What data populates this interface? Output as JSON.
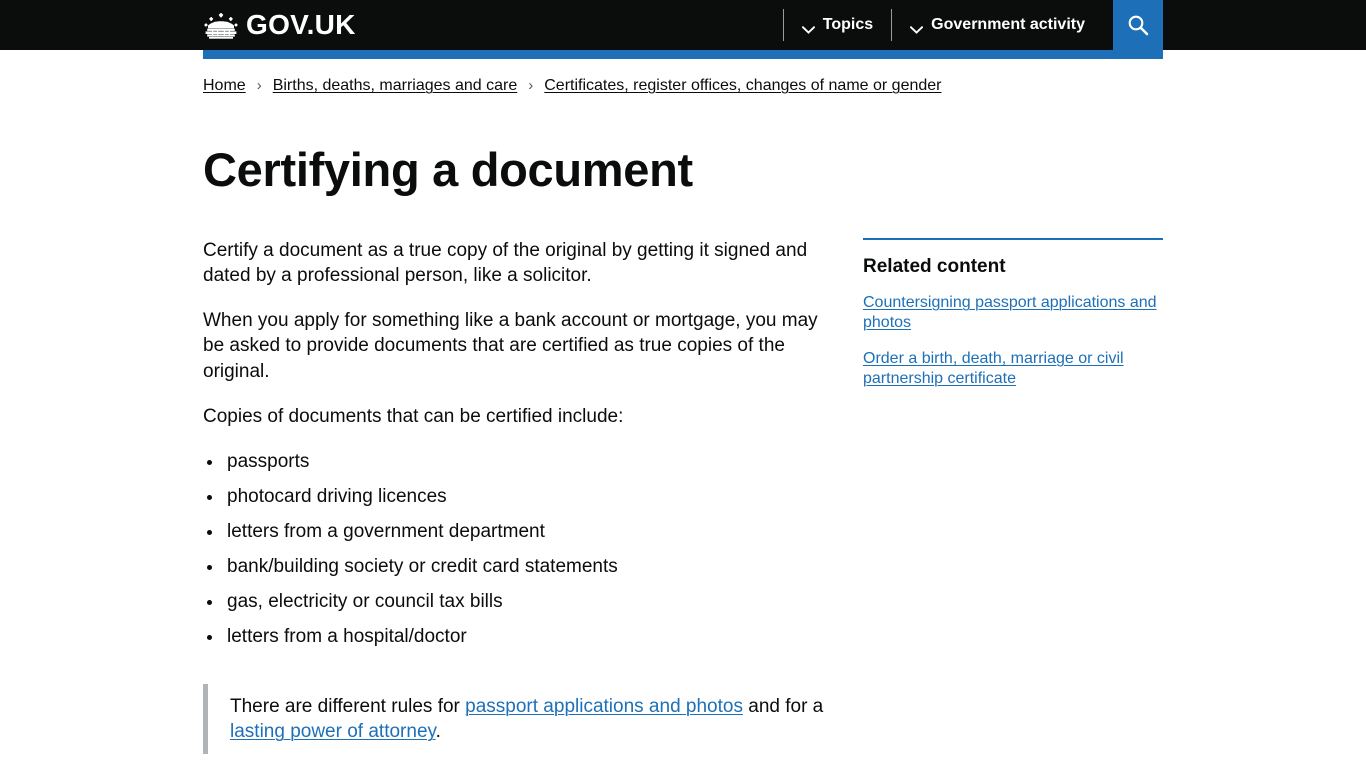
{
  "header": {
    "logo_text": "GOV.UK",
    "nav": [
      {
        "label": "Topics",
        "icon": "chevron-down-icon"
      },
      {
        "label": "Government activity",
        "icon": "chevron-down-icon"
      }
    ],
    "search_label": "Search",
    "accent_color": "#1d70b8",
    "background_color": "#0b0c0c"
  },
  "breadcrumb": {
    "items": [
      "Home",
      "Births, deaths, marriages and care",
      "Certificates, register offices, changes of name or gender"
    ],
    "separator": "›"
  },
  "main": {
    "title": "Certifying a document",
    "paragraphs": [
      "Certify a document as a true copy of the original by getting it signed and dated by a professional person, like a solicitor.",
      "When you apply for something like a bank account or mortgage, you may be asked to provide documents that are certified as true copies of the original.",
      "Copies of documents that can be certified include:"
    ],
    "list_items": [
      "passports",
      "photocard driving licences",
      "letters from a government department",
      "bank/building society or credit card statements",
      "gas, electricity or council tax bills",
      "letters from a hospital/doctor"
    ],
    "inset": {
      "text_before": "There are different rules for ",
      "link_1": "passport applications and photos",
      "text_middle": " and for a ",
      "link_2": "lasting power of attorney",
      "text_after": "."
    }
  },
  "sidebar": {
    "title": "Related content",
    "links": [
      "Countersigning passport applications and photos",
      "Order a birth, death, marriage or civil partnership certificate"
    ]
  }
}
